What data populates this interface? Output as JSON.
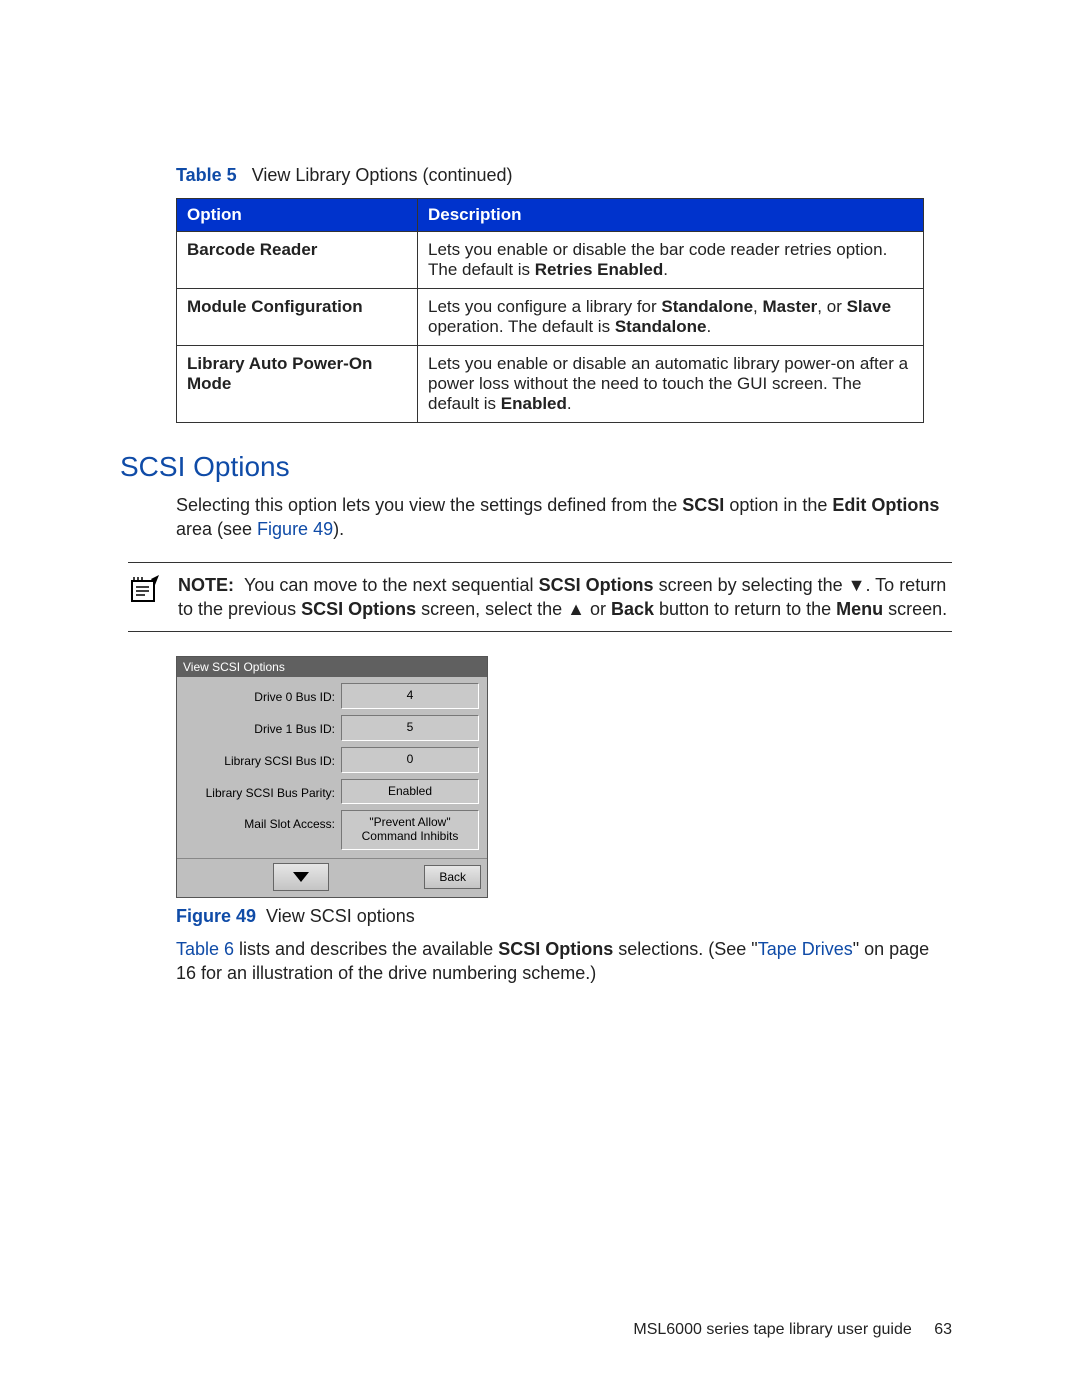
{
  "table5": {
    "label": "Table 5",
    "title": "View Library Options (continued)",
    "headers": {
      "option": "Option",
      "description": "Description"
    },
    "rows": [
      {
        "option": "Barcode Reader",
        "desc_pre": "Lets you enable or disable the bar code reader retries option. The default is ",
        "desc_bold": "Retries Enabled",
        "desc_post": "."
      },
      {
        "option": "Module Configuration",
        "desc_pre": "Lets you configure a library for ",
        "b1": "Standalone",
        "sep1": ", ",
        "b2": "Master",
        "sep2": ", or ",
        "b3": "Slave",
        "desc_mid": " operation. The default is ",
        "b4": "Standalone",
        "desc_post": "."
      },
      {
        "option": "Library Auto Power-On Mode",
        "desc_pre": "Lets you enable or disable an automatic library power-on after a power loss without the need to touch the GUI screen. The default is ",
        "desc_bold": "Enabled",
        "desc_post": "."
      }
    ]
  },
  "section_heading": "SCSI Options",
  "intro": {
    "pre": "Selecting this option lets you view the settings defined from the ",
    "b1": "SCSI",
    "mid1": " option in the ",
    "b2": "Edit Options",
    "mid2": " area (see ",
    "link1": "Figure 49",
    "post": ")."
  },
  "note": {
    "label": "NOTE:",
    "t1": "You can move to the next sequential ",
    "b1": "SCSI Options",
    "t2": " screen by selecting the ▼. To return to the previous ",
    "b2": "SCSI Options",
    "t3": " screen, select the ▲ or ",
    "b3": "Back",
    "t4": " button to return to the ",
    "b4": "Menu",
    "t5": " screen."
  },
  "lcd": {
    "title": "View SCSI Options",
    "rows": [
      {
        "label": "Drive 0 Bus ID:",
        "value": "4"
      },
      {
        "label": "Drive 1 Bus ID:",
        "value": "5"
      },
      {
        "label": "Library SCSI Bus ID:",
        "value": "0"
      },
      {
        "label": "Library SCSI Bus Parity:",
        "value": "Enabled"
      },
      {
        "label": "Mail Slot Access:",
        "value": "\"Prevent Allow\"\nCommand Inhibits"
      }
    ],
    "back": "Back"
  },
  "figure": {
    "label": "Figure 49",
    "title": "View SCSI options"
  },
  "closing": {
    "link1": "Table 6",
    "t1": " lists and describes the available ",
    "b1": "SCSI Options",
    "t2": " selections. (See \"",
    "link2": "Tape Drives",
    "t3": "\" on page 16 for an illustration of the drive numbering scheme.)"
  },
  "footer": {
    "title": "MSL6000 series tape library user guide",
    "page": "63"
  }
}
